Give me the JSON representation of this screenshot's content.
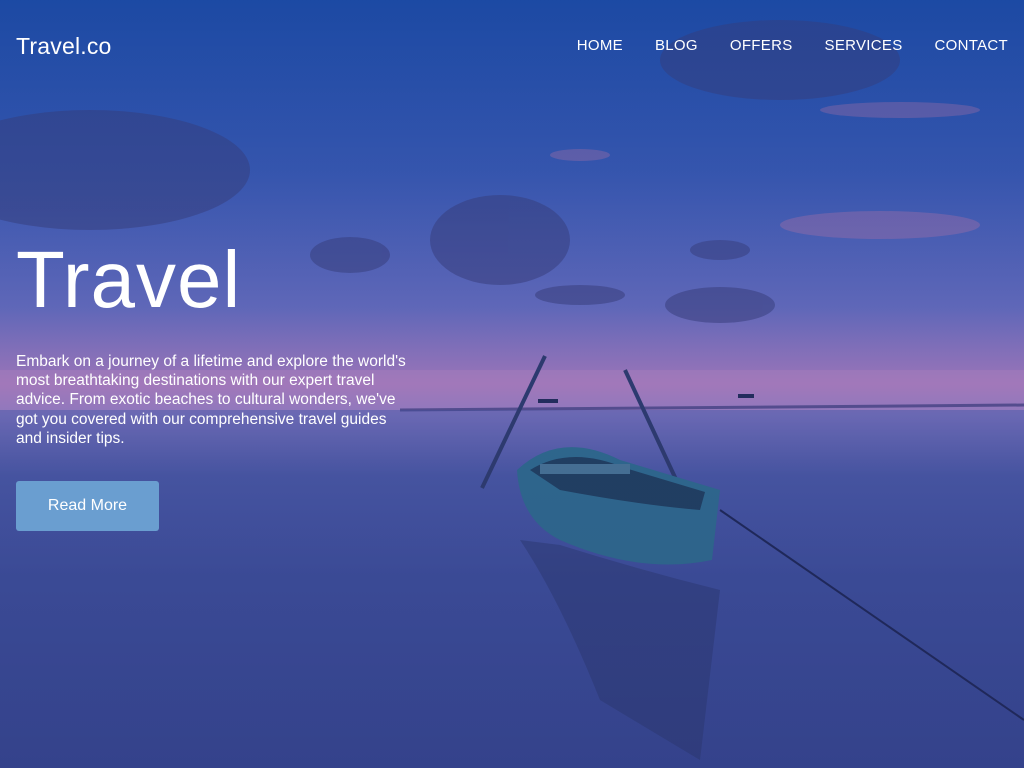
{
  "header": {
    "brand": "Travel.co",
    "nav": [
      "HOME",
      "BLOG",
      "OFFERS",
      "SERVICES",
      "CONTACT"
    ]
  },
  "hero": {
    "title": "Travel",
    "description": "Embark on a journey of a lifetime and explore the world's most breathtaking destinations with our expert travel advice. From exotic beaches to cultural wonders, we've got you covered with our comprehensive travel guides and insider tips.",
    "button_label": "Read More",
    "background_image": "boat-on-calm-sea-at-dusk"
  },
  "colors": {
    "button": "#6a9ed0",
    "sky_top": "#1f4ea8",
    "horizon": "#b07fc0"
  }
}
